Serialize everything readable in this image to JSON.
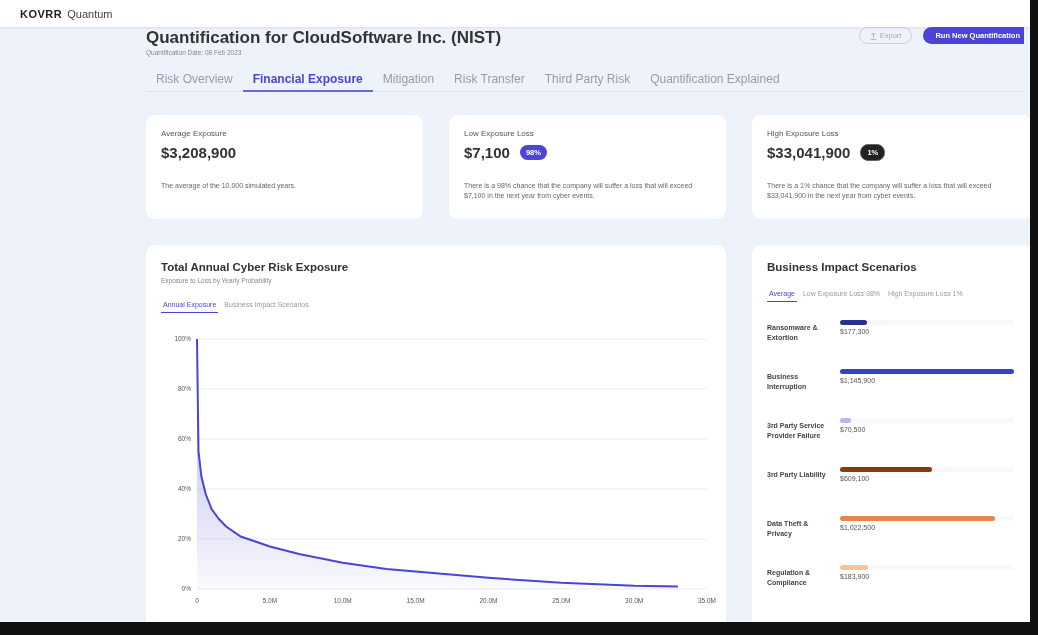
{
  "app": {
    "logo": "KOVRR",
    "product": "Quantum"
  },
  "header": {
    "title": "Quantification for CloudSoftware Inc. (NIST)",
    "date": "Quantification Date: 08 Feb 2023",
    "buttons": [
      {
        "label": "Export",
        "kind": "outline"
      },
      {
        "label": "Run New Quantification",
        "kind": "primary"
      }
    ]
  },
  "tabs": [
    {
      "label": "Risk Overview",
      "selected": false
    },
    {
      "label": "Financial Exposure",
      "selected": true
    },
    {
      "label": "Mitigation",
      "selected": false
    },
    {
      "label": "Risk Transfer",
      "selected": false
    },
    {
      "label": "Third Party Risk",
      "selected": false
    },
    {
      "label": "Quantification Explained",
      "selected": false
    }
  ],
  "cards": [
    {
      "label": "Average Exposure",
      "value": "$3,208,900",
      "description": "The average of the 10,000 simulated years."
    },
    {
      "label": "Low Exposure Loss",
      "value": "$7,100",
      "badge": {
        "text": "98%",
        "kind": "filled"
      },
      "description": "There is a 98% chance that the company will suffer a loss that will exceed $7,100 in the next year from cyber events."
    },
    {
      "label": "High Exposure Loss",
      "value": "$33,041,900",
      "badge": {
        "text": "1%",
        "kind": "dark"
      },
      "description": "There is a 1% chance that the company will suffer a loss that will exceed $33,041,900 in the next year from cyber events."
    }
  ],
  "exposure_panel": {
    "title": "Total Annual Cyber Risk Exposure",
    "subtitle": "Exposure to Loss by Yearly Probability",
    "tabs": [
      {
        "label": "Annual Exposure",
        "selected": true
      },
      {
        "label": "Business Impact Scenarios",
        "selected": false
      }
    ],
    "chart_data": {
      "type": "area",
      "x": [
        0,
        0.1,
        0.3,
        0.6,
        1,
        1.5,
        2,
        3,
        4,
        5,
        7,
        10,
        13,
        16,
        20,
        25,
        30,
        33
      ],
      "grid": true,
      "series": [
        {
          "color": "#4a45d6",
          "values": [
            100,
            55,
            45,
            38,
            32,
            28,
            25,
            21,
            19,
            17,
            14,
            10.5,
            8,
            6.5,
            4.5,
            2.5,
            1.3,
            1
          ]
        }
      ],
      "xlim": [
        0,
        35
      ],
      "ylim": [
        0,
        100
      ],
      "xticks": [
        {
          "value": 0,
          "label": "0"
        },
        {
          "value": 5,
          "label": "5.0M"
        },
        {
          "value": 10,
          "label": "10.0M"
        },
        {
          "value": 15,
          "label": "15.0M"
        },
        {
          "value": 20,
          "label": "20.0M"
        },
        {
          "value": 25,
          "label": "25.0M"
        },
        {
          "value": 30,
          "label": "30.0M"
        },
        {
          "value": 35,
          "label": "35.0M"
        }
      ],
      "yticks": [
        {
          "value": 0,
          "label": "0%"
        },
        {
          "value": 20,
          "label": "20%"
        },
        {
          "value": 40,
          "label": "40%"
        },
        {
          "value": 60,
          "label": "60%"
        },
        {
          "value": 80,
          "label": "80%"
        },
        {
          "value": 100,
          "label": "100%"
        }
      ]
    }
  },
  "scenarios_panel": {
    "title": "Business Impact Scenarios",
    "tabs": [
      {
        "label": "Average",
        "selected": true
      },
      {
        "label": "Low Exposure Loss 98%",
        "selected": false
      },
      {
        "label": "High Exposure Loss 1%",
        "selected": false
      }
    ],
    "scenarios": [
      {
        "name": "Ransomware & Extortion",
        "value": "$177,300",
        "level": 0.155,
        "color": "#2b2f8f"
      },
      {
        "name": "Business Interruption",
        "value": "$1,145,900",
        "level": 1,
        "color": "#3b3fc9"
      },
      {
        "name": "3rd Party Service Provider Failure",
        "value": "$70,500",
        "level": 0.062,
        "color": "#b8b6f0"
      },
      {
        "name": "3rd Party Liability",
        "value": "$609,100",
        "level": 0.53,
        "color": "#8a3a10"
      },
      {
        "name": "Data Theft & Privacy",
        "value": "$1,022,500",
        "level": 0.89,
        "color": "#e8874a"
      },
      {
        "name": "Regulation & Compliance",
        "value": "$183,900",
        "level": 0.16,
        "color": "#f6c49a"
      }
    ]
  }
}
